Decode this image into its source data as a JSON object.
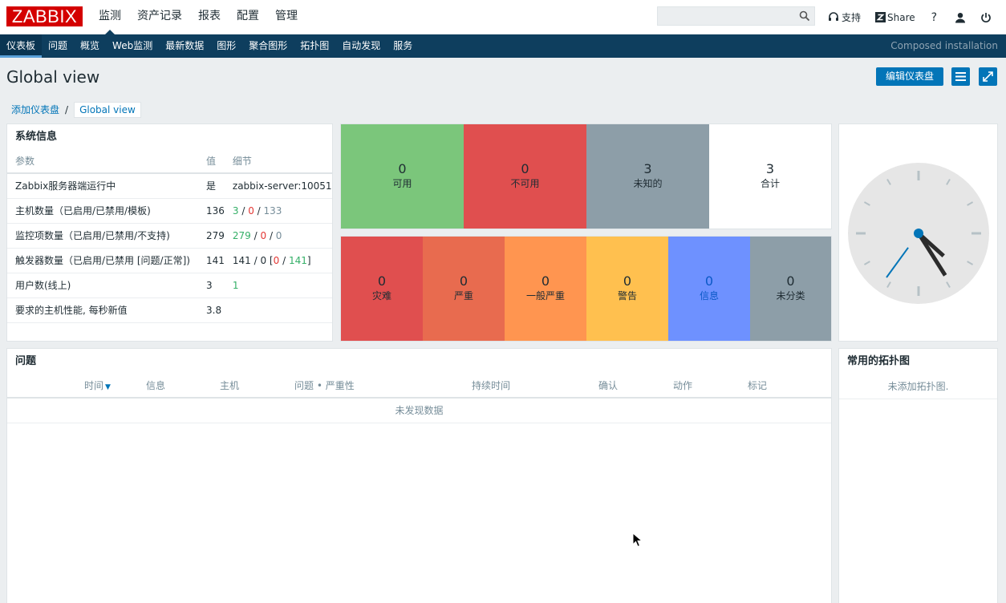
{
  "app": {
    "logo": "ZABBIX",
    "top_menu": [
      {
        "label": "监测"
      },
      {
        "label": "资产记录"
      },
      {
        "label": "报表"
      },
      {
        "label": "配置"
      },
      {
        "label": "管理"
      }
    ],
    "search": {
      "value": "",
      "placeholder": ""
    },
    "top_links": {
      "support": "支持",
      "share": "Share",
      "help": "?"
    },
    "sub_menu": [
      {
        "label": "仪表板"
      },
      {
        "label": "问题"
      },
      {
        "label": "概览"
      },
      {
        "label": "Web监测"
      },
      {
        "label": "最新数据"
      },
      {
        "label": "图形"
      },
      {
        "label": "聚合图形"
      },
      {
        "label": "拓扑图"
      },
      {
        "label": "自动发现"
      },
      {
        "label": "服务"
      }
    ],
    "installation": "Composed installation"
  },
  "page": {
    "title": "Global view",
    "edit_button": "编辑仪表盘",
    "breadcrumb": {
      "parent": "添加仪表盘",
      "separator": "/",
      "current": "Global view"
    }
  },
  "system_info": {
    "title": "系统信息",
    "headers": {
      "param": "参数",
      "value": "值",
      "details": "细节"
    },
    "rows": [
      {
        "param": "Zabbix服务器端运行中",
        "value": "是",
        "details": [
          {
            "t": "zabbix-server:10051",
            "c": ""
          }
        ]
      },
      {
        "param": "主机数量（已启用/已禁用/模板)",
        "value": "136",
        "details": [
          {
            "t": "3",
            "c": "green"
          },
          {
            "t": " / ",
            "c": ""
          },
          {
            "t": "0",
            "c": "red"
          },
          {
            "t": " / ",
            "c": ""
          },
          {
            "t": "133",
            "c": "grey"
          }
        ]
      },
      {
        "param": "监控项数量（已启用/已禁用/不支持)",
        "value": "279",
        "details": [
          {
            "t": "279",
            "c": "green"
          },
          {
            "t": " / ",
            "c": ""
          },
          {
            "t": "0",
            "c": "red"
          },
          {
            "t": " / ",
            "c": ""
          },
          {
            "t": "0",
            "c": "grey"
          }
        ]
      },
      {
        "param": "触发器数量（已启用/已禁用 [问题/正常])",
        "value": "141",
        "details": [
          {
            "t": "141 / 0 [",
            "c": ""
          },
          {
            "t": "0",
            "c": "red"
          },
          {
            "t": " / ",
            "c": ""
          },
          {
            "t": "141",
            "c": "green"
          },
          {
            "t": "]",
            "c": ""
          }
        ]
      },
      {
        "param": "用户数(线上)",
        "value": "3",
        "details": [
          {
            "t": "1",
            "c": "green"
          }
        ]
      },
      {
        "param": "要求的主机性能, 每秒新值",
        "value": "3.8",
        "details": []
      }
    ]
  },
  "host_availability": [
    {
      "count": "0",
      "label": "可用",
      "color": "#7bc67b"
    },
    {
      "count": "0",
      "label": "不可用",
      "color": "#e04f4f"
    },
    {
      "count": "3",
      "label": "未知的",
      "color": "#8d9ea8"
    },
    {
      "count": "3",
      "label": "合计",
      "color": "#ffffff"
    }
  ],
  "problems_by_severity": [
    {
      "count": "0",
      "label": "灾难",
      "color": "#e04f4f"
    },
    {
      "count": "0",
      "label": "严重",
      "color": "#e86b4f"
    },
    {
      "count": "0",
      "label": "一般严重",
      "color": "#ff9550"
    },
    {
      "count": "0",
      "label": "警告",
      "color": "#ffc04f"
    },
    {
      "count": "0",
      "label": "信息",
      "color": "#6e91ff"
    },
    {
      "count": "0",
      "label": "未分类",
      "color": "#8d9ea8"
    }
  ],
  "clock": {
    "hour": 4,
    "minute": 24,
    "second": 36
  },
  "problems": {
    "title": "问题",
    "columns": [
      "时间",
      "信息",
      "主机",
      "问题 • 严重性",
      "持续时间",
      "确认",
      "动作",
      "标记"
    ],
    "empty": "未发现数据"
  },
  "favorite_maps": {
    "title": "常用的拓扑图",
    "empty": "未添加拓扑图."
  }
}
